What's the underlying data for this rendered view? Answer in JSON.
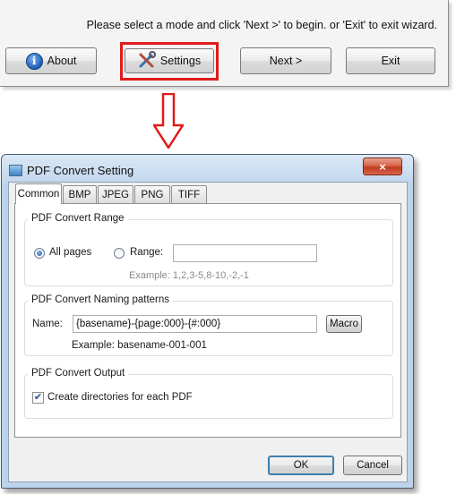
{
  "wizard": {
    "message": "Please select a mode and click 'Next >' to begin. or 'Exit' to exit wizard.",
    "buttons": {
      "about": "About",
      "settings": "Settings",
      "next": "Next >",
      "exit": "Exit"
    }
  },
  "dialog": {
    "title": "PDF Convert Setting",
    "close_glyph": "×",
    "tabs": [
      "Common",
      "BMP",
      "JPEG",
      "PNG",
      "TIFF"
    ],
    "active_tab": "Common",
    "range_group": {
      "title": "PDF Convert Range",
      "all_pages_label": "All pages",
      "range_label": "Range:",
      "range_value": "",
      "example": "Example: 1,2,3-5,8-10,-2,-1",
      "selected": "all_pages"
    },
    "naming_group": {
      "title": "PDF Convert Naming patterns",
      "name_label": "Name:",
      "name_value": "{basename}-{page:000}-{#:000}",
      "macro_label": "Macro",
      "example": "Example:  basename-001-001"
    },
    "output_group": {
      "title": "PDF Convert Output",
      "create_dirs_label": "Create directories for each PDF",
      "create_dirs_checked": true
    },
    "ok_label": "OK",
    "cancel_label": "Cancel"
  },
  "colors": {
    "highlight_red": "#e01b1b",
    "dialog_frame": "#bcd3ea",
    "close_red": "#c03a1e"
  },
  "icons": [
    "info-icon",
    "settings-tools-icon",
    "down-arrow-icon",
    "window-icon",
    "close-icon",
    "checkmark-icon"
  ]
}
